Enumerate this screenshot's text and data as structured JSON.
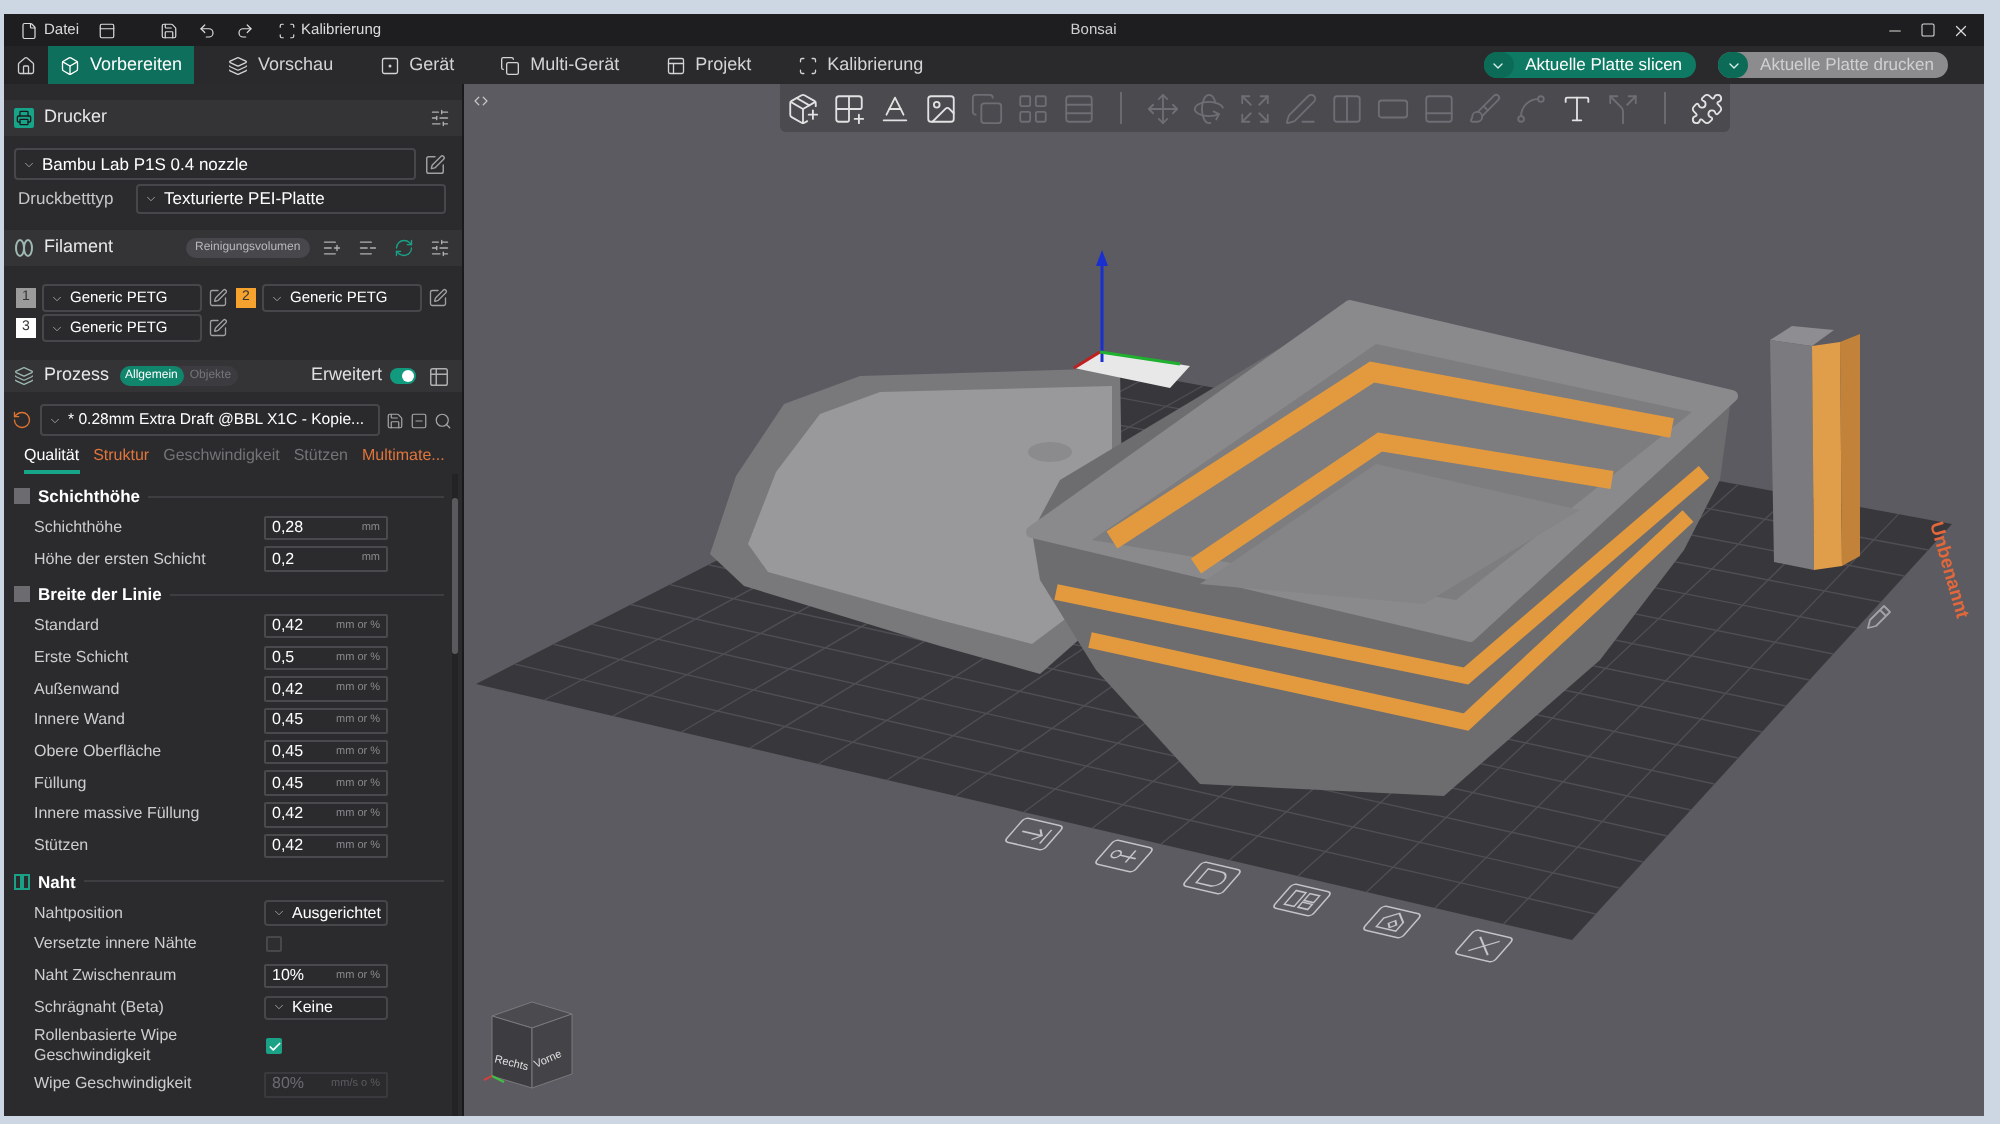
{
  "window": {
    "title": "Bonsai"
  },
  "title_bar": {
    "menu": "Datei",
    "calibration": "Kalibrierung"
  },
  "tabs": [
    {
      "label": "Vorbereiten",
      "selected": true
    },
    {
      "label": "Vorschau",
      "selected": false
    },
    {
      "label": "Gerät",
      "selected": false
    },
    {
      "label": "Multi-Gerät",
      "selected": false
    },
    {
      "label": "Projekt",
      "selected": false
    },
    {
      "label": "Kalibrierung",
      "selected": false
    }
  ],
  "actions": [
    {
      "label": "Aktuelle Platte slicen",
      "disabled": false
    },
    {
      "label": "Aktuelle Platte drucken",
      "disabled": true
    }
  ],
  "printer": {
    "title": "Drucker",
    "preset": "Bambu Lab P1S 0.4 nozzle",
    "bed_label": "Druckbetttyp",
    "bed_type": "Texturierte PEI-Platte"
  },
  "filament": {
    "title": "Filament",
    "flush_button": "Reinigungsvolumen",
    "slots": [
      {
        "number": "1",
        "color": "#9b9b9b",
        "name": "Generic PETG"
      },
      {
        "number": "2",
        "color": "#f5a22e",
        "name": "Generic PETG"
      },
      {
        "number": "3",
        "color": "#ffffff",
        "name": "Generic PETG"
      }
    ]
  },
  "process": {
    "title": "Prozess",
    "modes": [
      {
        "label": "Allgemein",
        "selected": true
      },
      {
        "label": "Objekte",
        "selected": false
      }
    ],
    "advanced_label": "Erweitert",
    "advanced_on": true,
    "preset": "* 0.28mm Extra Draft @BBL X1C - Kopie...",
    "tabs": [
      {
        "label": "Qualität",
        "selected": true,
        "modified": false
      },
      {
        "label": "Struktur",
        "selected": false,
        "modified": true
      },
      {
        "label": "Geschwindigkeit",
        "selected": false,
        "modified": false
      },
      {
        "label": "Stützen",
        "selected": false,
        "modified": false
      },
      {
        "label": "Multimate...",
        "selected": false,
        "modified": true
      }
    ],
    "groups": [
      {
        "title": "Schichthöhe",
        "rows": [
          {
            "kind": "number",
            "label": "Schichthöhe",
            "value": "0,28",
            "unit": "mm",
            "disabled": false
          },
          {
            "kind": "number",
            "label": "Höhe der ersten Schicht",
            "value": "0,2",
            "unit": "mm",
            "disabled": false
          }
        ]
      },
      {
        "title": "Breite der Linie",
        "rows": [
          {
            "kind": "number",
            "label": "Standard",
            "value": "0,42",
            "unit": "mm or %",
            "disabled": false
          },
          {
            "kind": "number",
            "label": "Erste Schicht",
            "value": "0,5",
            "unit": "mm or %",
            "disabled": false
          },
          {
            "kind": "number",
            "label": "Außenwand",
            "value": "0,42",
            "unit": "mm or %",
            "disabled": false
          },
          {
            "kind": "number",
            "label": "Innere Wand",
            "value": "0,45",
            "unit": "mm or %",
            "disabled": false
          },
          {
            "kind": "number",
            "label": "Obere Oberfläche",
            "value": "0,45",
            "unit": "mm or %",
            "disabled": false
          },
          {
            "kind": "number",
            "label": "Füllung",
            "value": "0,45",
            "unit": "mm or %",
            "disabled": false
          },
          {
            "kind": "number",
            "label": "Innere massive Füllung",
            "value": "0,42",
            "unit": "mm or %",
            "disabled": false
          },
          {
            "kind": "number",
            "label": "Stützen",
            "value": "0,42",
            "unit": "mm or %",
            "disabled": false
          }
        ]
      },
      {
        "title": "Naht",
        "rows": [
          {
            "kind": "select",
            "label": "Nahtposition",
            "value": "Ausgerichtet",
            "disabled": false
          },
          {
            "kind": "checkbox",
            "label": "Versetzte innere Nähte",
            "checked": false,
            "disabled": false
          },
          {
            "kind": "number",
            "label": "Naht Zwischenraum",
            "value": "10%",
            "unit": "mm or %",
            "disabled": false
          },
          {
            "kind": "select",
            "label": "Schrägnaht (Beta)",
            "value": "Keine",
            "disabled": false
          },
          {
            "kind": "checkbox",
            "label": "Rollenbasierte Wipe Geschwindigkeit",
            "checked": true,
            "disabled": false
          },
          {
            "kind": "number",
            "label": "Wipe Geschwindigkeit",
            "value": "80%",
            "unit": "mm/s o %",
            "disabled": true
          }
        ]
      }
    ]
  },
  "toolbar": {
    "groups": [
      {
        "tools": [
          {
            "disabled": false
          },
          {
            "disabled": false
          },
          {
            "disabled": false
          },
          {
            "disabled": false
          },
          {
            "disabled": true
          },
          {
            "disabled": true
          },
          {
            "disabled": true
          }
        ]
      },
      {
        "tools": [
          {
            "disabled": true
          },
          {
            "disabled": true
          },
          {
            "disabled": true
          },
          {
            "disabled": true
          },
          {
            "disabled": true
          },
          {
            "disabled": true
          },
          {
            "disabled": true
          },
          {
            "disabled": true
          },
          {
            "disabled": true
          },
          {
            "disabled": false
          },
          {
            "disabled": true
          }
        ]
      },
      {
        "tools": [
          {
            "disabled": false
          }
        ]
      }
    ]
  },
  "viewport": {
    "plate_name": "Unbenannt",
    "view_cube": [
      "Rechts",
      "Vorne"
    ]
  }
}
